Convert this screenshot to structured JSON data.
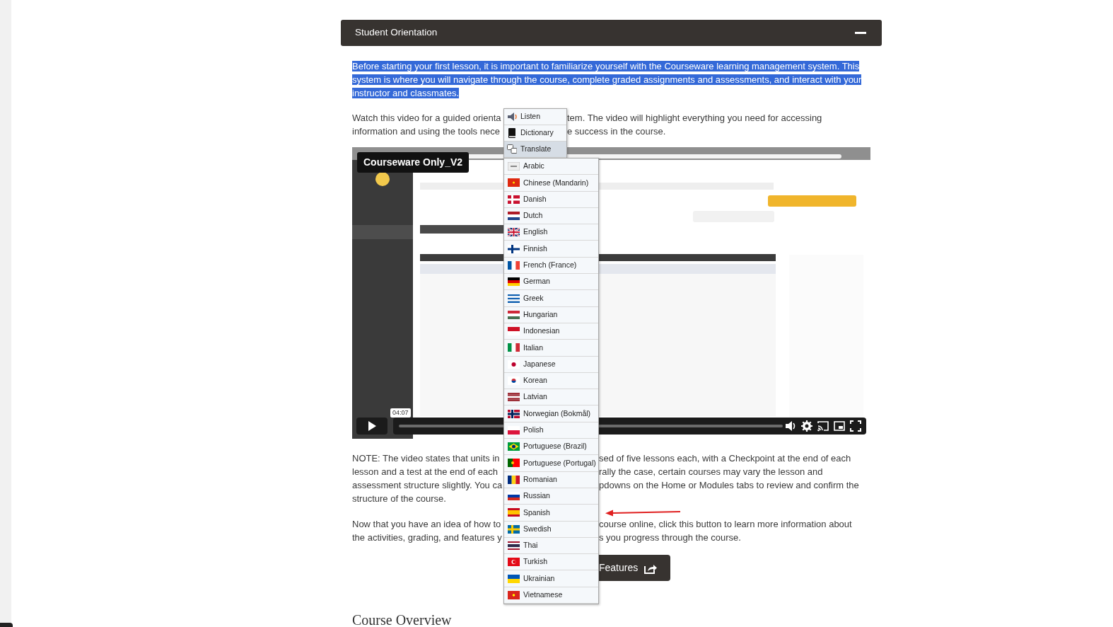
{
  "panel": {
    "title": "Student Orientation",
    "expanded": true
  },
  "intro": {
    "text": "Before starting your first lesson, it is important to familiarize yourself with the Courseware learning management system. This system is where you will navigate through the course, complete graded assignments and assessments, and interact with your instructor and classmates.",
    "selected": true
  },
  "watch_paragraph": {
    "lines": [
      {
        "left": "Watch this video for a guided orienta",
        "right": "tem. The video will highlight everything you need for accessing"
      },
      {
        "left": "information and using the tools nece",
        "right": "e success in the course."
      }
    ]
  },
  "video": {
    "title": "Courseware Only_V2",
    "time_tooltip": "04:07"
  },
  "note_paragraph": {
    "lines": [
      {
        "left": "NOTE: The video states that units in",
        "right": "sed of five lessons each, with a Checkpoint at the end of each"
      },
      {
        "left": "lesson and a test at the end of each",
        "right": "rally the case, certain courses may vary the lesson and"
      },
      {
        "left": "assessment structure slightly. You ca",
        "right": "pdowns on the Home or Modules tabs to review and confirm the"
      },
      {
        "left": "structure of the course."
      }
    ]
  },
  "next_paragraph": {
    "lines": [
      {
        "left": "Now that you have an idea of how to",
        "right": "course online, click this button to learn more information about"
      },
      {
        "left": "the activities, grading, and features y",
        "right": "s you progress through the course."
      }
    ]
  },
  "features_button": {
    "label": "Features"
  },
  "section_heading": "Course Overview",
  "context_menu": {
    "items": [
      {
        "label": "Listen",
        "selected": false
      },
      {
        "label": "Dictionary",
        "selected": false
      },
      {
        "label": "Translate",
        "selected": true
      }
    ]
  },
  "translate_submenu": {
    "items": [
      {
        "label": "Arabic"
      },
      {
        "label": "Chinese (Mandarin)"
      },
      {
        "label": "Danish"
      },
      {
        "label": "Dutch"
      },
      {
        "label": "English"
      },
      {
        "label": "Finnish"
      },
      {
        "label": "French (France)"
      },
      {
        "label": "German"
      },
      {
        "label": "Greek"
      },
      {
        "label": "Hungarian"
      },
      {
        "label": "Indonesian"
      },
      {
        "label": "Italian"
      },
      {
        "label": "Japanese"
      },
      {
        "label": "Korean"
      },
      {
        "label": "Latvian"
      },
      {
        "label": "Norwegian (Bokmål)"
      },
      {
        "label": "Polish"
      },
      {
        "label": "Portuguese (Brazil)"
      },
      {
        "label": "Portuguese (Portugal)"
      },
      {
        "label": "Romanian"
      },
      {
        "label": "Russian"
      },
      {
        "label": "Spanish"
      },
      {
        "label": "Swedish"
      },
      {
        "label": "Thai"
      },
      {
        "label": "Turkish"
      },
      {
        "label": "Ukrainian"
      },
      {
        "label": "Vietnamese"
      }
    ]
  }
}
